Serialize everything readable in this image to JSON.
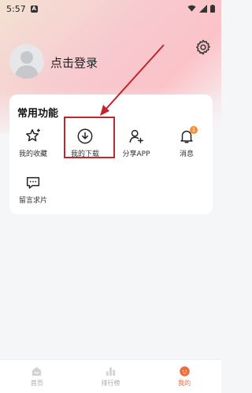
{
  "status_bar": {
    "time": "5:57",
    "notification_glyph": "A"
  },
  "profile": {
    "login_label": "点击登录"
  },
  "features_card": {
    "title": "常用功能",
    "items": [
      {
        "label": "我的收藏",
        "icon": "star-sparkle-icon"
      },
      {
        "label": "我的下载",
        "icon": "download-icon"
      },
      {
        "label": "分享APP",
        "icon": "user-add-icon"
      },
      {
        "label": "消息",
        "icon": "bell-icon",
        "badge": "1"
      },
      {
        "label": "留言求片",
        "icon": "message-bubble-icon"
      }
    ]
  },
  "tabbar": {
    "tabs": [
      {
        "label": "首页",
        "icon": "home-icon",
        "active": false
      },
      {
        "label": "排行榜",
        "icon": "bar-chart-icon",
        "active": false
      },
      {
        "label": "我的",
        "icon": "profile-face-icon",
        "active": true
      }
    ]
  },
  "colors": {
    "accent": "#f06a3a",
    "badge": "#ff8c2e",
    "annotation": "#c0262c"
  }
}
